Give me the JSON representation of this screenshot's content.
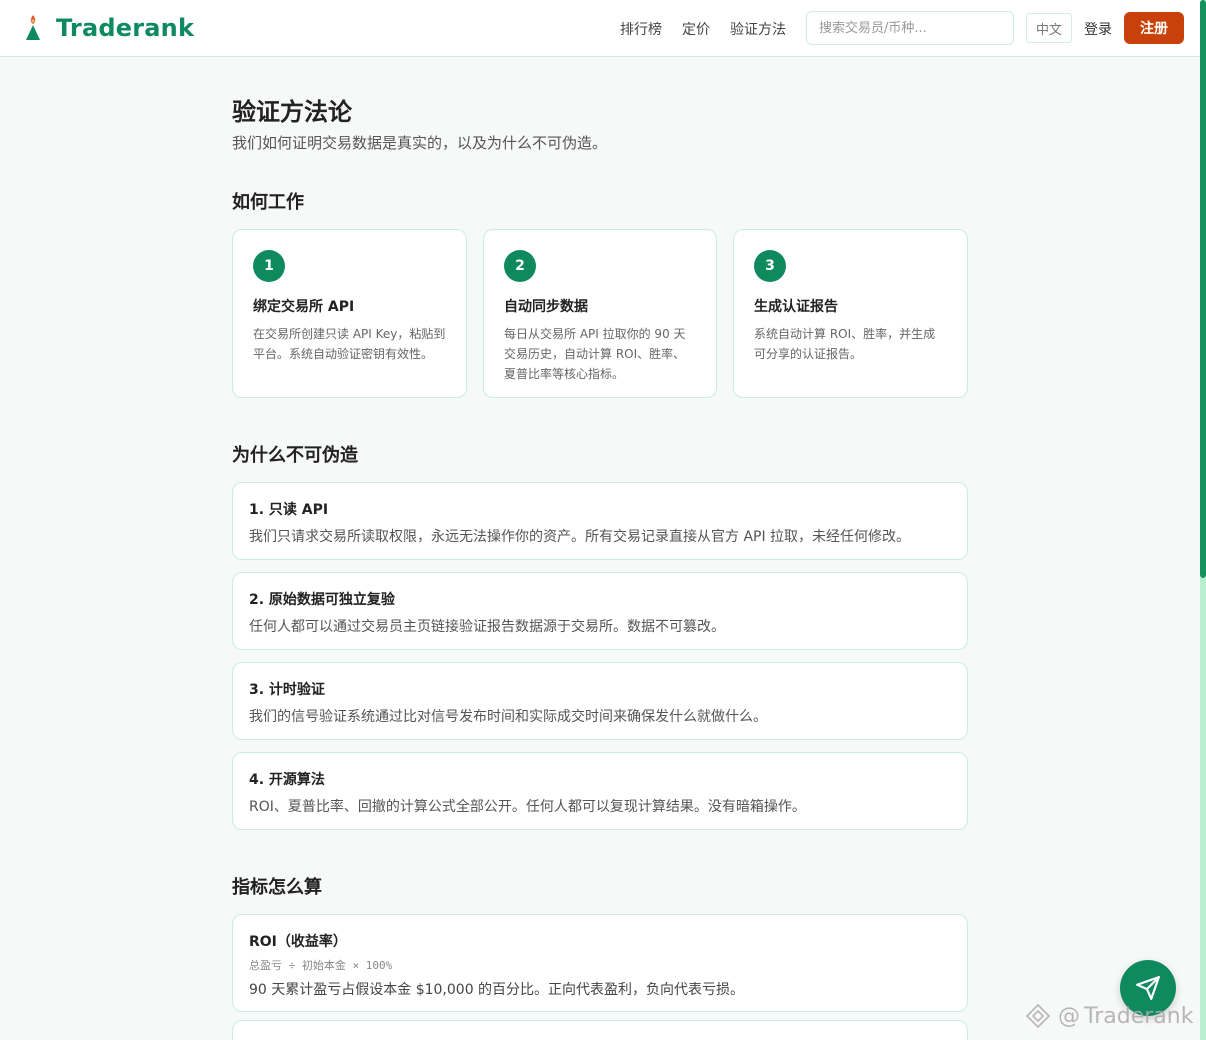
{
  "brand": {
    "name": "Traderank",
    "color": "#0f8a5f"
  },
  "nav": {
    "items": [
      {
        "label": "排行榜"
      },
      {
        "label": "定价"
      },
      {
        "label": "验证方法"
      }
    ],
    "search_placeholder": "搜索交易员/币种...",
    "lang": "中文",
    "login": "登录",
    "register": "注册"
  },
  "page": {
    "title": "验证方法论",
    "subtitle": "我们如何证明交易数据是真实的，以及为什么不可伪造。"
  },
  "how": {
    "title": "如何工作",
    "steps": [
      {
        "num": "1",
        "title": "绑定交易所 API",
        "desc": "在交易所创建只读 API Key，粘贴到平台。系统自动验证密钥有效性。"
      },
      {
        "num": "2",
        "title": "自动同步数据",
        "desc": "每日从交易所 API 拉取你的 90 天交易历史，自动计算 ROI、胜率、夏普比率等核心指标。"
      },
      {
        "num": "3",
        "title": "生成认证报告",
        "desc": "系统自动计算 ROI、胜率，并生成可分享的认证报告。"
      }
    ]
  },
  "why": {
    "title": "为什么不可伪造",
    "reasons": [
      {
        "title": "1. 只读 API",
        "desc": "我们只请求交易所读取权限，永远无法操作你的资产。所有交易记录直接从官方 API 拉取，未经任何修改。"
      },
      {
        "title": "2. 原始数据可独立复验",
        "desc": "任何人都可以通过交易员主页链接验证报告数据源于交易所。数据不可篡改。"
      },
      {
        "title": "3. 计时验证",
        "desc": "我们的信号验证系统通过比对信号发布时间和实际成交时间来确保发什么就做什么。"
      },
      {
        "title": "4. 开源算法",
        "desc": "ROI、夏普比率、回撤的计算公式全部公开。任何人都可以复现计算结果。没有暗箱操作。"
      }
    ]
  },
  "metrics": {
    "title": "指标怎么算",
    "items": [
      {
        "title": "ROI（收益率）",
        "formula": "总盈亏 ÷ 初始本金 × 100%",
        "desc": "90 天累计盈亏占假设本金 $10,000 的百分比。正向代表盈利，负向代表亏损。"
      }
    ]
  },
  "fab": {
    "icon": "send-icon"
  },
  "watermark": {
    "text": "Traderank"
  },
  "colors": {
    "accent": "#0f8a5f",
    "register": "#c9410a",
    "border": "#c9efda"
  }
}
